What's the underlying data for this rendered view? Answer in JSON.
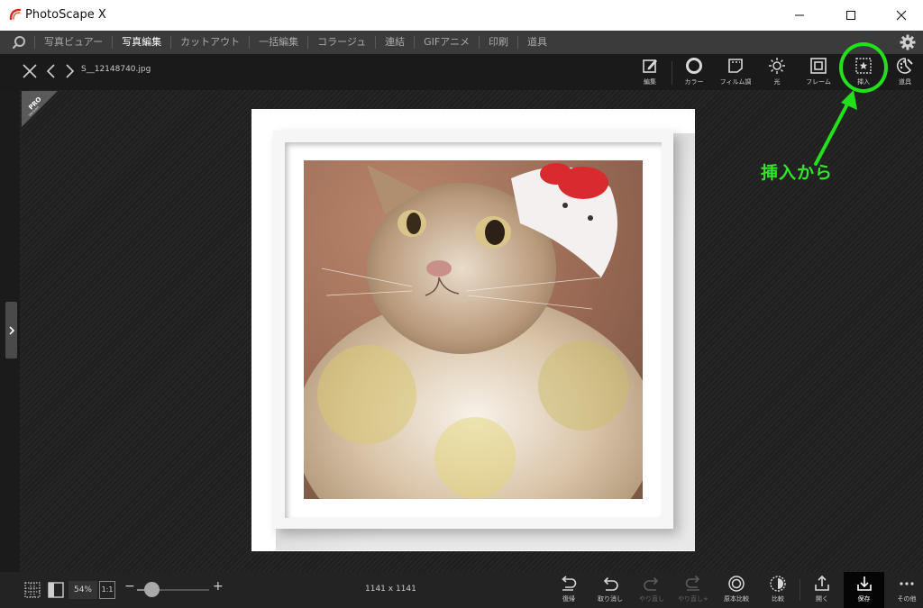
{
  "window": {
    "title": "PhotoScape X"
  },
  "menu": {
    "items": [
      {
        "label": "写真ビュアー",
        "active": false
      },
      {
        "label": "写真編集",
        "active": true
      },
      {
        "label": "カットアウト",
        "active": false
      },
      {
        "label": "一括編集",
        "active": false
      },
      {
        "label": "コラージュ",
        "active": false
      },
      {
        "label": "連結",
        "active": false
      },
      {
        "label": "GIFアニメ",
        "active": false
      },
      {
        "label": "印刷",
        "active": false
      },
      {
        "label": "道具",
        "active": false
      }
    ]
  },
  "editor": {
    "file_name": "S__12148740.jpg",
    "tools": [
      {
        "label": "編集",
        "icon": "edit-icon"
      },
      {
        "label": "カラー",
        "icon": "color-icon"
      },
      {
        "label": "フィルム調",
        "icon": "film-icon"
      },
      {
        "label": "光",
        "icon": "light-icon"
      },
      {
        "label": "フレーム",
        "icon": "frame-icon"
      },
      {
        "label": "挿入",
        "icon": "insert-icon"
      },
      {
        "label": "道具",
        "icon": "tools-icon"
      }
    ],
    "pro_badge": "PRO",
    "pro_sub": "Version"
  },
  "annotation": {
    "text": "挿入から",
    "color": "#22e01a"
  },
  "bottom": {
    "zoom": "54%",
    "zoom_ratio_label": "1:1",
    "zoom_minus": "−",
    "zoom_plus": "+",
    "zoom_level": 0.2,
    "dimensions": "1141 x 1141",
    "actions": [
      {
        "label": "復帰",
        "icon": "revert-icon",
        "enabled": true
      },
      {
        "label": "取り消し",
        "icon": "undo-icon",
        "enabled": true
      },
      {
        "label": "やり直し",
        "icon": "redo-icon",
        "enabled": false
      },
      {
        "label": "やり直し+",
        "icon": "redo-all-icon",
        "enabled": false
      },
      {
        "label": "原本比較",
        "icon": "compare-original-icon",
        "enabled": true
      },
      {
        "label": "比較",
        "icon": "compare-icon",
        "enabled": true
      },
      {
        "label": "開く",
        "icon": "open-icon",
        "enabled": true
      },
      {
        "label": "保存",
        "icon": "save-icon",
        "enabled": true
      },
      {
        "label": "その他",
        "icon": "more-icon",
        "enabled": true
      }
    ]
  },
  "colors": {
    "accent": "#22e01a",
    "toolbar_bg": "#1a1a1a",
    "menubar_bg": "#3b3b3b"
  }
}
